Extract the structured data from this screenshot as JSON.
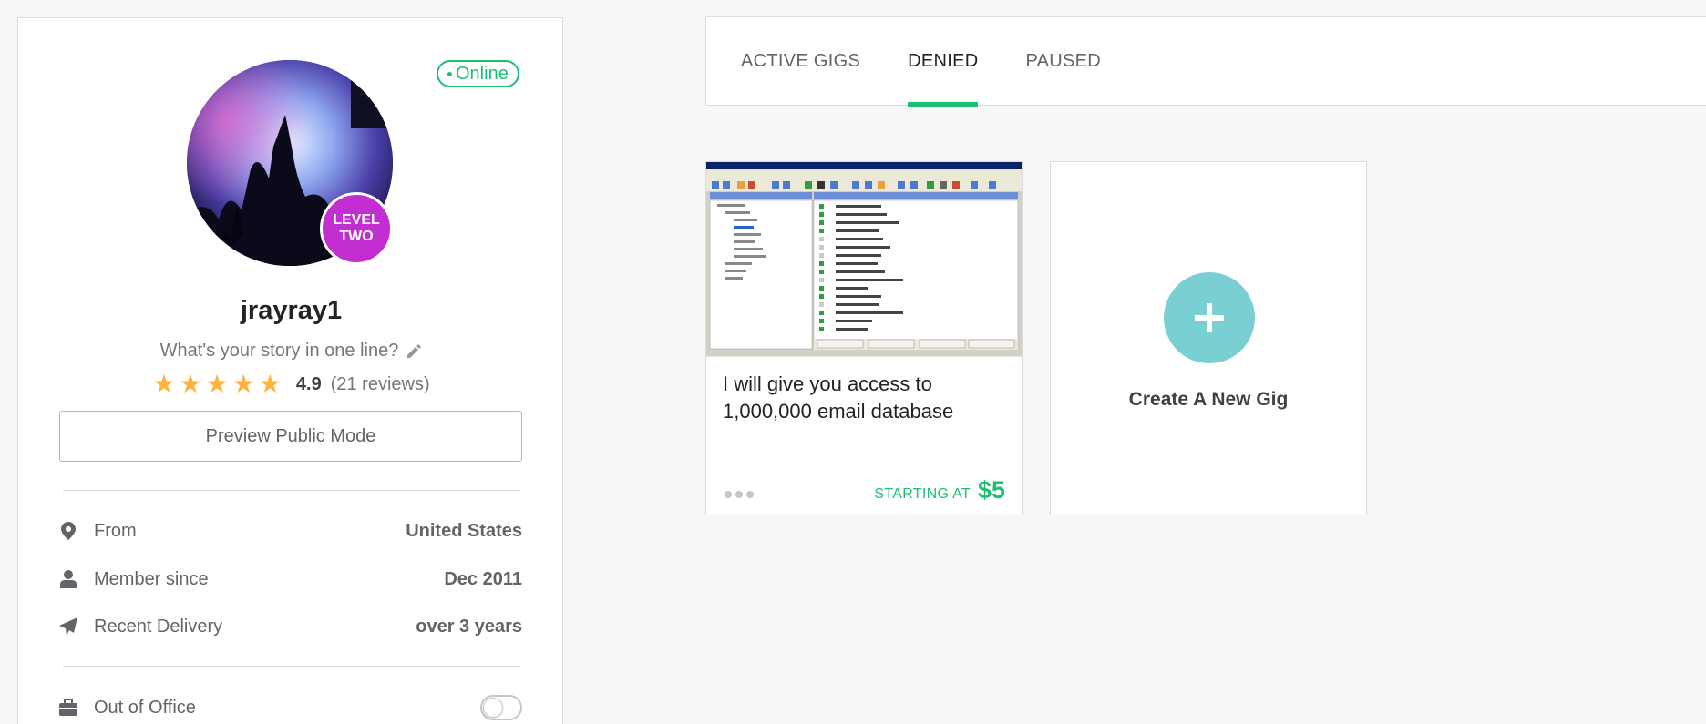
{
  "profile": {
    "status": "Online",
    "level_line1": "LEVEL",
    "level_line2": "TWO",
    "username": "jrayray1",
    "tagline": "What's your story in one line?",
    "rating": "4.9",
    "reviews": "(21 reviews)",
    "stars": 5,
    "preview_button": "Preview Public Mode",
    "info": [
      {
        "icon": "location-pin-icon",
        "label": "From",
        "value": "United States"
      },
      {
        "icon": "user-icon",
        "label": "Member since",
        "value": "Dec 2011"
      },
      {
        "icon": "paper-plane-icon",
        "label": "Recent Delivery",
        "value": "over 3 years"
      }
    ],
    "out_of_office": {
      "icon": "briefcase-icon",
      "label": "Out of Office",
      "on": false
    }
  },
  "tabs": [
    {
      "label": "ACTIVE GIGS",
      "active": false
    },
    {
      "label": "DENIED",
      "active": true
    },
    {
      "label": "PAUSED",
      "active": false
    }
  ],
  "gig": {
    "title": "I will give you access to 1,000,000 email database",
    "starting_at": "STARTING AT",
    "price": "$5"
  },
  "create_gig": {
    "label": "Create A New Gig"
  },
  "colors": {
    "accent": "#1dbf73",
    "level_badge": "#c22ed0",
    "create_circle": "#7acfd3",
    "star": "#ffb33e"
  }
}
